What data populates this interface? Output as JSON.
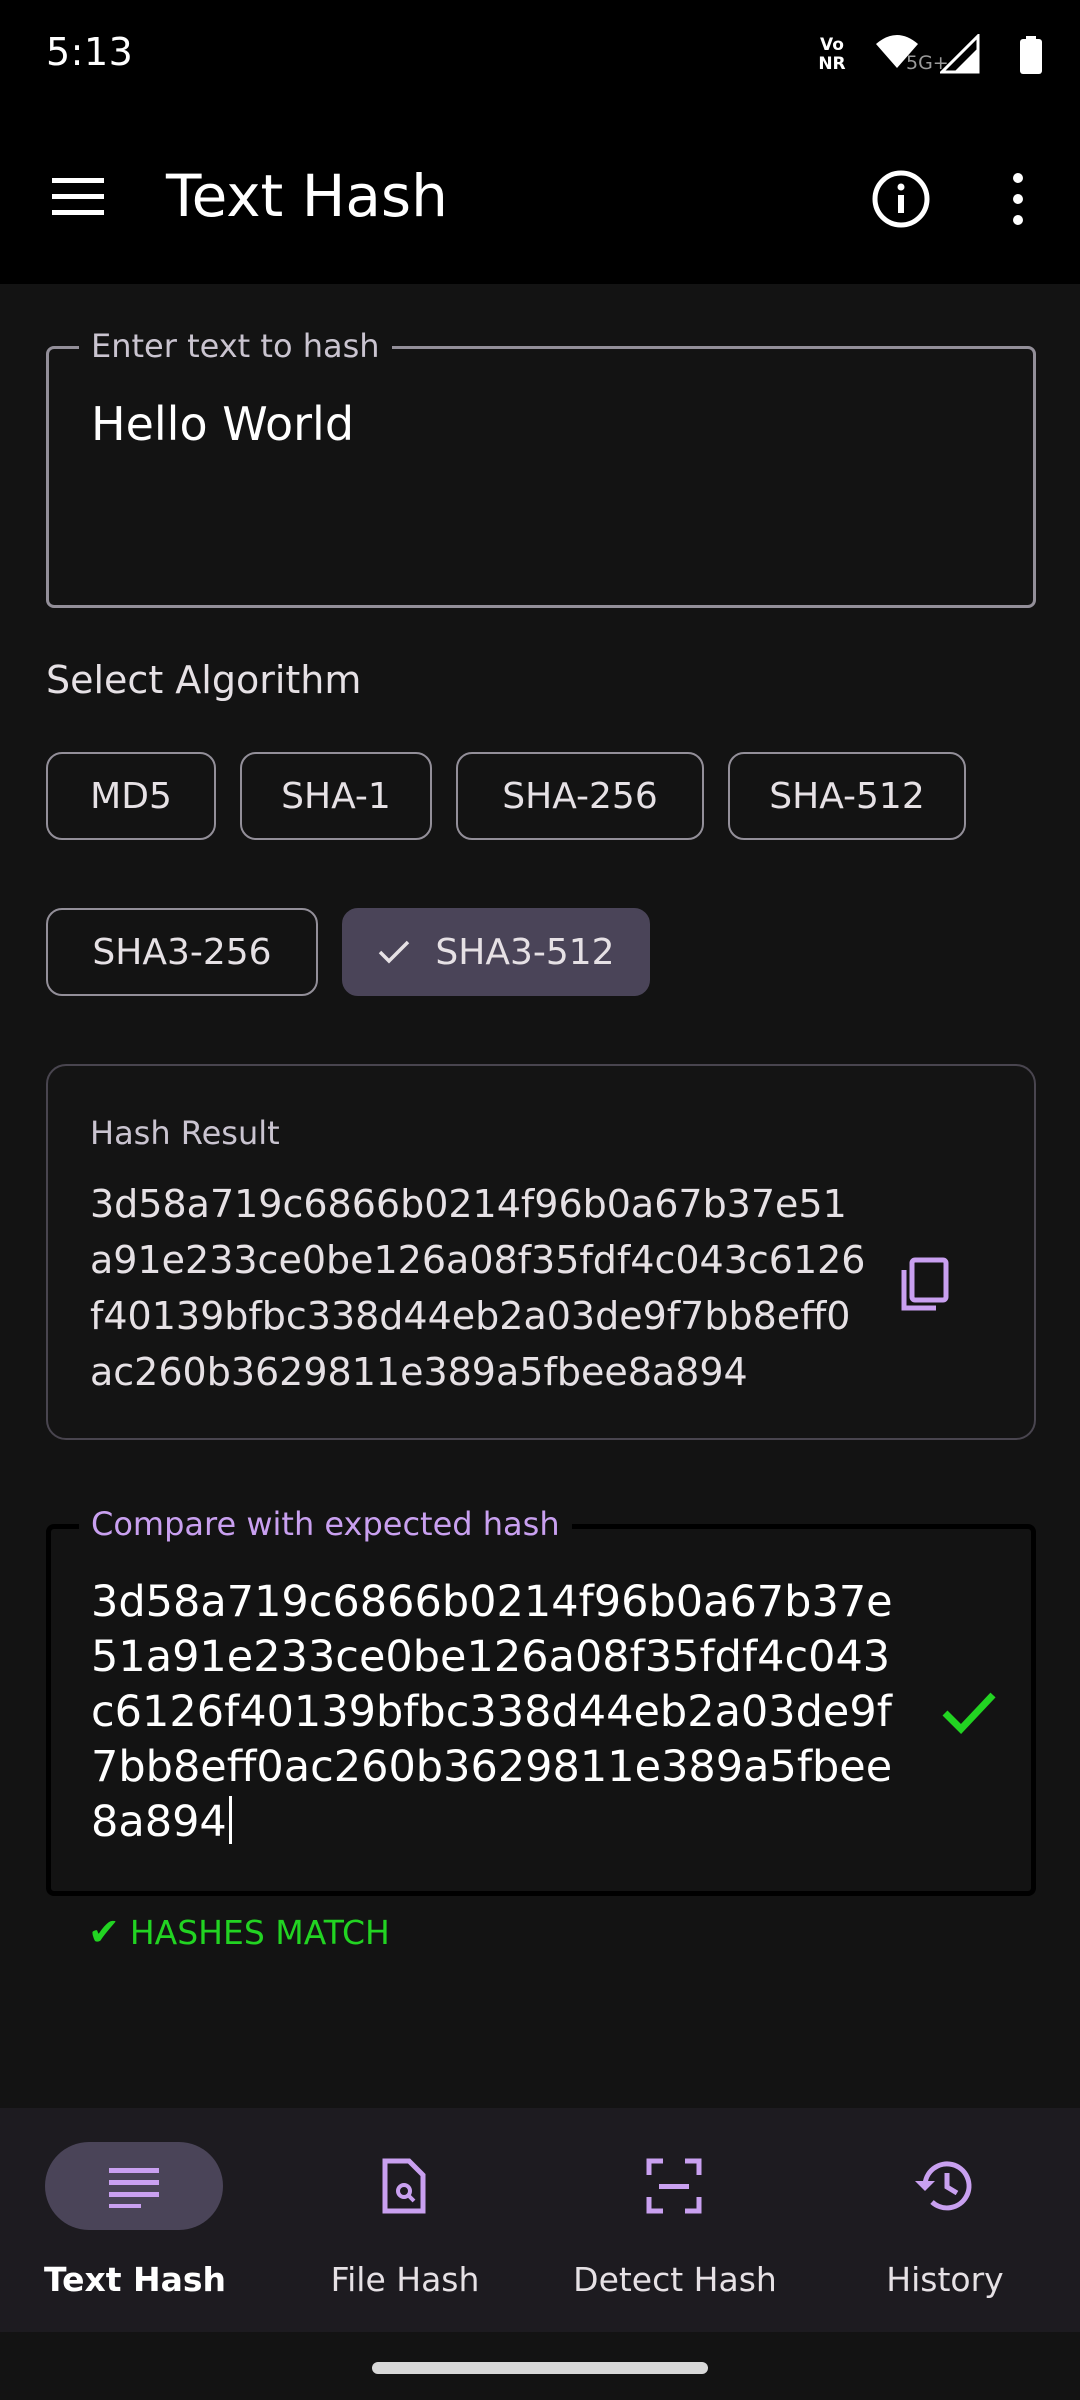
{
  "status_bar": {
    "time": "5:13",
    "volte_line1": "Vo",
    "volte_line2": "NR",
    "network": "5G+"
  },
  "app_bar": {
    "title": "Text Hash",
    "icons": [
      "menu-icon",
      "info-icon",
      "more-vert-icon"
    ]
  },
  "input": {
    "label": "Enter text to hash",
    "value": "Hello World"
  },
  "algorithm": {
    "label": "Select Algorithm",
    "options": [
      "MD5",
      "SHA-1",
      "SHA-256",
      "SHA-512",
      "SHA3-256",
      "SHA3-512"
    ],
    "selected": "SHA3-512"
  },
  "result": {
    "title": "Hash Result",
    "hash": "3d58a719c6866b0214f96b0a67b37e51a91e233ce0be126a08f35fdf4c043c6126f40139bfbc338d44eb2a03de9f7bb8eff0ac260b3629811e389a5fbee8a894"
  },
  "compare": {
    "label": "Compare with expected hash",
    "value": "3d58a719c6866b0214f96b0a67b37e51a91e233ce0be126a08f35fdf4c043c6126f40139bfbc338d44eb2a03de9f7bb8eff0ac260b3629811e389a5fbee8a894",
    "status_symbol": "✔",
    "status_text": "HASHES MATCH"
  },
  "bottom_nav": {
    "items": [
      {
        "label": "Text Hash",
        "icon": "text-lines-icon",
        "active": true
      },
      {
        "label": "File Hash",
        "icon": "file-icon",
        "active": false
      },
      {
        "label": "Detect Hash",
        "icon": "scan-icon",
        "active": false
      },
      {
        "label": "History",
        "icon": "history-icon",
        "active": false
      }
    ]
  },
  "colors": {
    "accent": "#c9a0f0",
    "match_green": "#22d422",
    "chip_selected": "#4a4458",
    "background": "#131313"
  }
}
